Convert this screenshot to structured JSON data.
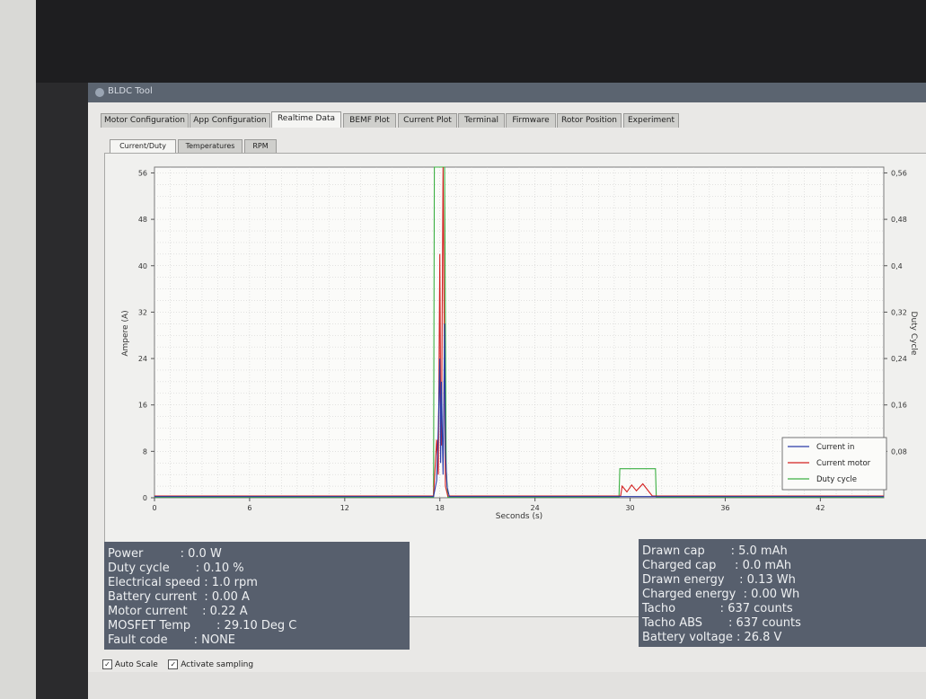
{
  "window": {
    "title": "BLDC Tool"
  },
  "tabs": [
    {
      "label": "Motor Configuration",
      "active": false
    },
    {
      "label": "App Configuration",
      "active": false
    },
    {
      "label": "Realtime Data",
      "active": true
    },
    {
      "label": "BEMF Plot",
      "active": false
    },
    {
      "label": "Current Plot",
      "active": false
    },
    {
      "label": "Terminal",
      "active": false
    },
    {
      "label": "Firmware",
      "active": false
    },
    {
      "label": "Rotor Position",
      "active": false
    },
    {
      "label": "Experiment",
      "active": false
    }
  ],
  "subtabs": [
    {
      "label": "Current/Duty",
      "active": true
    },
    {
      "label": "Temperatures",
      "active": false
    },
    {
      "label": "RPM",
      "active": false
    }
  ],
  "chart_data": {
    "type": "line",
    "xlabel": "Seconds (s)",
    "ylabel": "Ampere (A)",
    "y2label": "Duty Cycle",
    "xlim": [
      0,
      46
    ],
    "ylim": [
      0,
      57
    ],
    "y2lim": [
      0,
      0.57
    ],
    "x_ticks": [
      "0",
      "6",
      "12",
      "18",
      "24",
      "30",
      "36",
      "42"
    ],
    "y_ticks": [
      "0",
      "8",
      "16",
      "24",
      "32",
      "40",
      "48",
      "56"
    ],
    "y2_ticks": [
      "0,08",
      "0,16",
      "0,24",
      "0,32",
      "0,4",
      "0,48",
      "0,56"
    ],
    "grid": true,
    "legend_position": "bottom-right",
    "colors": {
      "current_in": "#2a3aa8",
      "current_motor": "#d42020",
      "duty_cycle": "#3cb043"
    },
    "series": [
      {
        "name": "Current in",
        "axis": "left",
        "points": [
          [
            0,
            0.2
          ],
          [
            17.6,
            0.2
          ],
          [
            17.8,
            3
          ],
          [
            17.9,
            12
          ],
          [
            18.0,
            24
          ],
          [
            18.05,
            6
          ],
          [
            18.1,
            20
          ],
          [
            18.2,
            4
          ],
          [
            18.3,
            30
          ],
          [
            18.35,
            8
          ],
          [
            18.45,
            2
          ],
          [
            18.6,
            0.2
          ],
          [
            46,
            0.2
          ]
        ]
      },
      {
        "name": "Current motor",
        "axis": "left",
        "points": [
          [
            0,
            0.3
          ],
          [
            17.6,
            0.3
          ],
          [
            17.8,
            10
          ],
          [
            17.9,
            4
          ],
          [
            18.0,
            42
          ],
          [
            18.05,
            15
          ],
          [
            18.1,
            9
          ],
          [
            18.2,
            57
          ],
          [
            18.3,
            22
          ],
          [
            18.35,
            2
          ],
          [
            18.5,
            0.3
          ],
          [
            29.4,
            0.3
          ],
          [
            29.5,
            2
          ],
          [
            29.8,
            1
          ],
          [
            30.1,
            2.2
          ],
          [
            30.4,
            1.2
          ],
          [
            30.8,
            2.4
          ],
          [
            31.2,
            1.0
          ],
          [
            31.4,
            0.3
          ],
          [
            46,
            0.3
          ]
        ]
      },
      {
        "name": "Duty cycle",
        "axis": "right",
        "points": [
          [
            0,
            0.001
          ],
          [
            17.6,
            0.001
          ],
          [
            17.65,
            0.57
          ],
          [
            18.3,
            0.57
          ],
          [
            18.4,
            0.05
          ],
          [
            18.5,
            0.001
          ],
          [
            29.3,
            0.001
          ],
          [
            29.35,
            0.05
          ],
          [
            31.6,
            0.05
          ],
          [
            31.65,
            0.001
          ],
          [
            46,
            0.001
          ]
        ]
      }
    ]
  },
  "left_panel": {
    "rows": [
      "Power          : 0.0 W",
      "Duty cycle       : 0.10 %",
      "Electrical speed : 1.0 rpm",
      "Battery current  : 0.00 A",
      "Motor current    : 0.22 A",
      "MOSFET Temp       : 29.10 Deg C",
      "Fault code       : NONE"
    ]
  },
  "right_panel": {
    "rows": [
      "Drawn cap       : 5.0 mAh",
      "Charged cap     : 0.0 mAh",
      "Drawn energy    : 0.13 Wh",
      "Charged energy  : 0.00 Wh",
      "Tacho            : 637 counts",
      "Tacho ABS       : 637 counts",
      "Battery voltage : 26.8 V"
    ]
  },
  "checkboxes": [
    {
      "label": "Auto Scale",
      "checked": true
    },
    {
      "label": "Activate sampling",
      "checked": true
    }
  ]
}
